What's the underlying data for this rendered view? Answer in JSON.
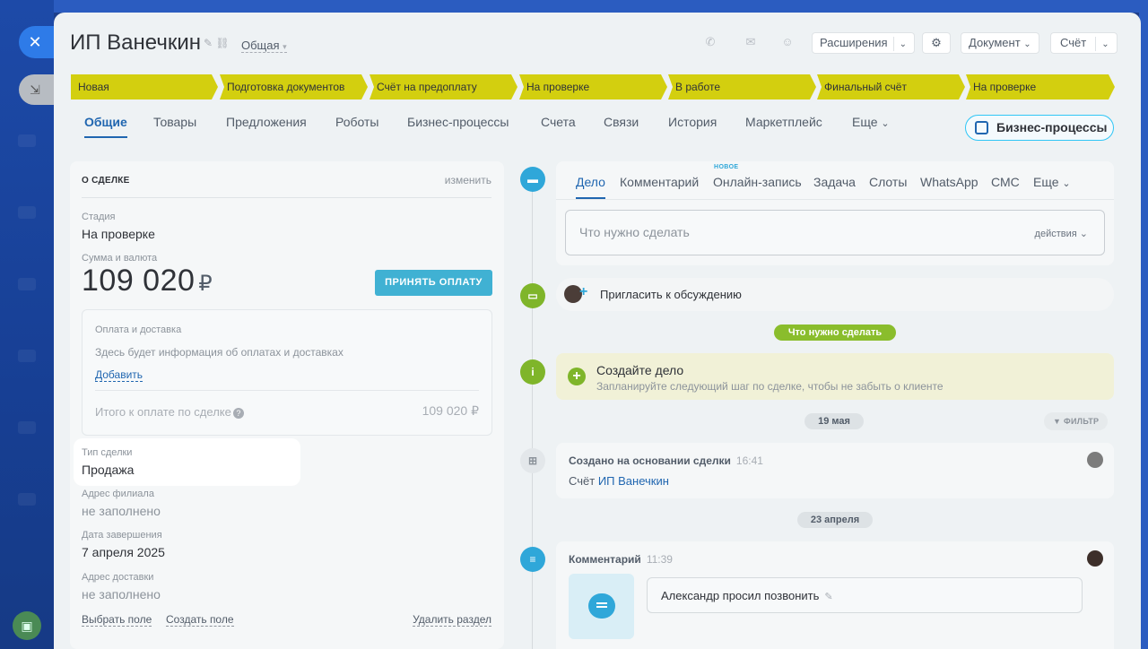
{
  "title": "ИП Ванечкин",
  "category": "Общая",
  "header_buttons": {
    "extensions": "Расширения",
    "document": "Документ",
    "invoice": "Счёт"
  },
  "stages": [
    "Новая",
    "Подготовка документов",
    "Счёт на предоплату",
    "На проверке",
    "В работе",
    "Финальный счёт",
    "На проверке"
  ],
  "tabs": [
    "Общие",
    "Товары",
    "Предложения",
    "Роботы",
    "Бизнес-процессы",
    "Счета",
    "Связи",
    "История",
    "Маркетплейс",
    "Еще"
  ],
  "bp_button": "Бизнес-процессы",
  "deal": {
    "section_title": "О СДЕЛКЕ",
    "edit_link": "изменить",
    "stage_label": "Стадия",
    "stage_value": "На проверке",
    "amount_label": "Сумма и валюта",
    "amount_value": "109 020",
    "currency": "₽",
    "accept_button": "ПРИНЯТЬ ОПЛАТУ",
    "payment": {
      "label": "Оплата и доставка",
      "text": "Здесь будет информация об оплатах и доставках",
      "add": "Добавить",
      "total_label": "Итого к оплате по сделке",
      "total_value": "109 020 ₽"
    },
    "type_label": "Тип сделки",
    "type_value": "Продажа",
    "branch_label": "Адрес филиала",
    "branch_value": "не заполнено",
    "close_label": "Дата завершения",
    "close_value": "7 апреля 2025",
    "delivery_label": "Адрес доставки",
    "delivery_value": "не заполнено",
    "select_field": "Выбрать поле",
    "create_field": "Создать поле",
    "delete_section": "Удалить раздел"
  },
  "editor": {
    "tabs": [
      "Дело",
      "Комментарий",
      "Онлайн-запись",
      "Задача",
      "Слоты",
      "WhatsApp",
      "СМС",
      "Еще"
    ],
    "new_badge": "НОВОЕ",
    "placeholder": "Что нужно сделать",
    "actions": "действия"
  },
  "invite_text": "Пригласить к обсуждению",
  "todo_pill": "Что нужно сделать",
  "todo": {
    "title": "Создайте дело",
    "subtitle": "Запланируйте следующий шаг по сделке, чтобы не забыть о клиенте"
  },
  "date1": "19 мая",
  "filter": "ФИЛЬТР",
  "created": {
    "title": "Создано на основании сделки",
    "time": "16:41",
    "prefix": "Счёт",
    "link": "ИП Ванечкин"
  },
  "date2": "23 апреля",
  "comment": {
    "title": "Комментарий",
    "time": "11:39",
    "text": "Александр просил позвонить"
  },
  "colors": {
    "stage": "#d3cf0f",
    "accent": "#2066b0",
    "accept": "#40b1d3",
    "timeline_blue": "#2fa7d9",
    "timeline_green": "#7fb52a"
  }
}
